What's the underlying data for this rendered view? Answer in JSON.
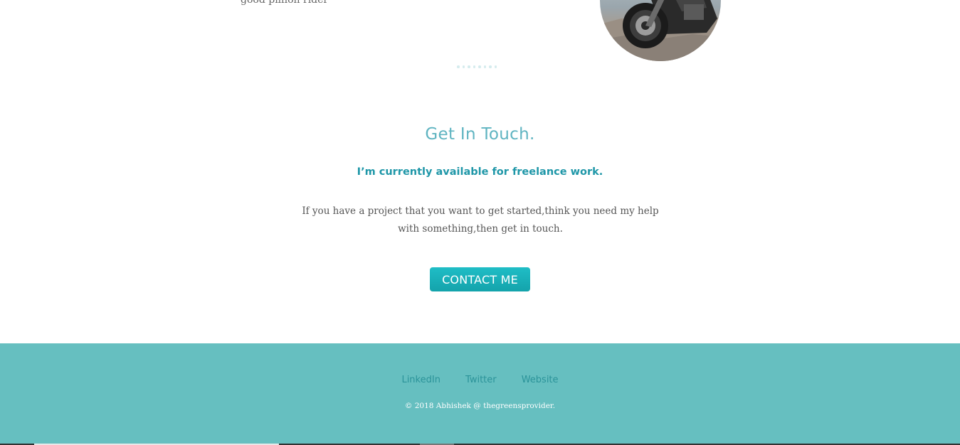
{
  "about": {
    "caption_fragment": "good pillion rider"
  },
  "carousel": {
    "dot_count": 8
  },
  "contact": {
    "title": "Get In Touch.",
    "subtitle": "I’m currently available for freelance work.",
    "body": "If you have a project that you want to get started,think you need my help with something,then get in touch.",
    "button_label": "CONTACT ME"
  },
  "footer": {
    "links": [
      {
        "label": "LinkedIn"
      },
      {
        "label": "Twitter"
      },
      {
        "label": "Website"
      }
    ],
    "copyright": "© 2018 Abhishek @ thegreensprovider."
  },
  "colors": {
    "accent": "#1f97a8",
    "title": "#5fb4c1",
    "button": "#14a3ab",
    "footer_bg": "#66bfc0",
    "footer_link": "#2b9399"
  }
}
